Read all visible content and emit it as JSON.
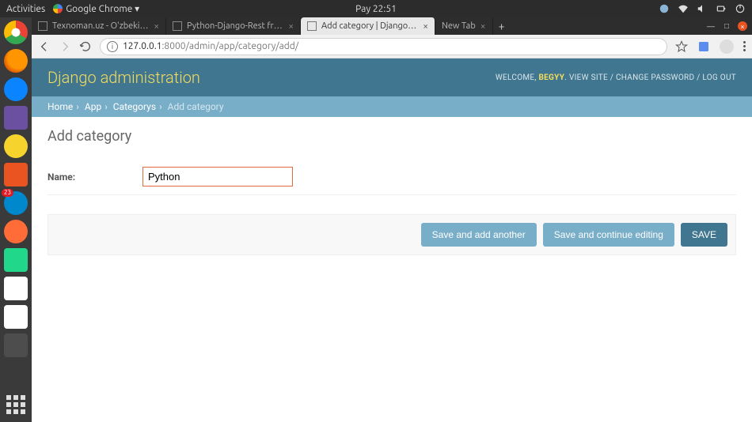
{
  "gnome": {
    "activities": "Activities",
    "app_indicator": "Google Chrome ▾",
    "clock": "Pay 22:51"
  },
  "dock": {
    "telegram_badge": "23"
  },
  "tabs": [
    {
      "title": "Texnoman.uz - O'zbekisto",
      "active": false
    },
    {
      "title": "Python-Django-Rest fram",
      "active": false
    },
    {
      "title": "Add category | Django sit",
      "active": true
    },
    {
      "title": "New Tab",
      "active": false
    }
  ],
  "address": {
    "host": "127.0.0.1",
    "path": ":8000/admin/app/category/add/"
  },
  "django": {
    "header_title": "Django administration",
    "welcome": "WELCOME, ",
    "username": "BEGYY",
    "links": {
      "view_site": "VIEW SITE",
      "change_password": "CHANGE PASSWORD",
      "log_out": "LOG OUT"
    },
    "breadcrumb": {
      "home": "Home",
      "app": "App",
      "categorys": "Categorys",
      "current": "Add category"
    },
    "page_title": "Add category",
    "form": {
      "name_label": "Name:",
      "name_value": "Python"
    },
    "buttons": {
      "save_add_another": "Save and add another",
      "save_continue": "Save and continue editing",
      "save": "SAVE"
    }
  }
}
